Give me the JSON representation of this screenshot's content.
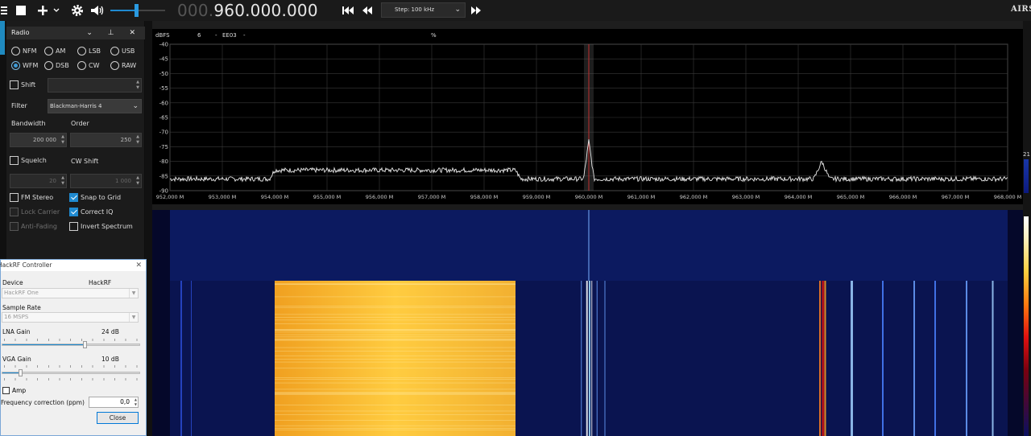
{
  "toolbar": {
    "menu_icon": "hamburger-icon",
    "freq_dim": "000.",
    "freq_value": "960.000.000",
    "step_label": "Step: 100 kHz",
    "logo_text": "AIRS"
  },
  "radio_panel": {
    "title": "Radio",
    "modes": [
      "NFM",
      "AM",
      "LSB",
      "USB",
      "WFM",
      "DSB",
      "CW",
      "RAW"
    ],
    "selected_mode": "WFM",
    "shift_label": "Shift",
    "filter_label": "Filter",
    "filter_value": "Blackman-Harris 4",
    "bandwidth_label": "Bandwidth",
    "bandwidth_value": "200 000",
    "order_label": "Order",
    "order_value": "250",
    "squelch_label": "Squelch",
    "squelch_value": "20",
    "cw_shift_label": "CW Shift",
    "cw_shift_value": "1 000",
    "fm_stereo_label": "FM Stereo",
    "snap_label": "Snap to Grid",
    "lock_carrier_label": "Lock Carrier",
    "correct_iq_label": "Correct IQ",
    "anti_fading_label": "Anti-Fading",
    "invert_label": "Invert Spectrum"
  },
  "hackrf": {
    "title": "HackRF Controller",
    "device_label": "Device",
    "device_name": "HackRF",
    "device_value": "HackRF One",
    "sample_rate_label": "Sample Rate",
    "sample_rate_value": "16 MSPS",
    "lna_label": "LNA Gain",
    "lna_value": "24 dB",
    "lna_level": 0.6,
    "vga_label": "VGA Gain",
    "vga_value": "10 dB",
    "vga_level": 0.13,
    "amp_label": "Amp",
    "freq_corr_label": "Frequency correction (ppm)",
    "freq_corr_value": "0,0",
    "close_label": "Close"
  },
  "spectrum": {
    "header_dbfs": "dBFS",
    "header_a": "6",
    "header_b": "-",
    "header_c": "EE03",
    "header_d": "-",
    "header_e": "%",
    "side_value": "21",
    "colors": {
      "trace": "#e8e8e8",
      "grid": "#3a3a3a",
      "marker": "#c03030"
    }
  },
  "chart_data": {
    "type": "line",
    "xlabel": "",
    "ylabel": "dBFS",
    "ylim": [
      -90,
      -40
    ],
    "xlim": [
      952.0,
      968.0
    ],
    "y_ticks": [
      "-40",
      "-45",
      "-50",
      "-55",
      "-60",
      "-65",
      "-70",
      "-75",
      "-80",
      "-85",
      "-90"
    ],
    "x_ticks": [
      "952,000 M",
      "953,000 M",
      "954,000 M",
      "955,000 M",
      "956,000 M",
      "957,000 M",
      "958,000 M",
      "959,000 M",
      "960,000 M",
      "961,000 M",
      "962,000 M",
      "963,000 M",
      "964,000 M",
      "965,000 M",
      "966,000 M",
      "967,000 M",
      "968,000 M"
    ],
    "x": [
      952.0,
      953.9,
      954.0,
      955.0,
      956.0,
      957.0,
      958.0,
      958.6,
      958.7,
      959.9,
      960.0,
      960.1,
      961.0,
      962.0,
      963.0,
      964.3,
      964.45,
      964.6,
      965.0,
      966.0,
      967.0,
      968.0
    ],
    "values": [
      -86,
      -86,
      -83,
      -83,
      -83,
      -83,
      -83,
      -83,
      -86,
      -86,
      -73,
      -86,
      -86,
      -86,
      -86,
      -86,
      -80,
      -86,
      -86,
      -86,
      -86,
      -86
    ],
    "grid": true
  }
}
